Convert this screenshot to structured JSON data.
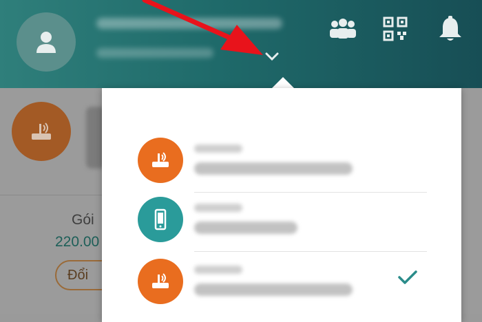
{
  "header": {
    "avatar_icon": "user-icon",
    "icons": [
      "group-icon",
      "qr-code-icon",
      "bell-icon"
    ],
    "colors": {
      "gradient_start": "#2f7f7b",
      "gradient_end": "#174e55"
    }
  },
  "background_card": {
    "package_label": "Gói",
    "price": "220.00",
    "change_button_label": "Đổi"
  },
  "account_menu": {
    "accounts": [
      {
        "type_icon": "router-icon",
        "color": "#e96d1f",
        "selected": false
      },
      {
        "type_icon": "mobile-phone-icon",
        "color": "#2a9b9a",
        "selected": false
      },
      {
        "type_icon": "router-icon",
        "color": "#e96d1f",
        "selected": true
      }
    ],
    "selected_icon": "check-icon",
    "accent_color": "#2a8c8a"
  },
  "annotation": {
    "arrow_color": "#e8131b"
  }
}
